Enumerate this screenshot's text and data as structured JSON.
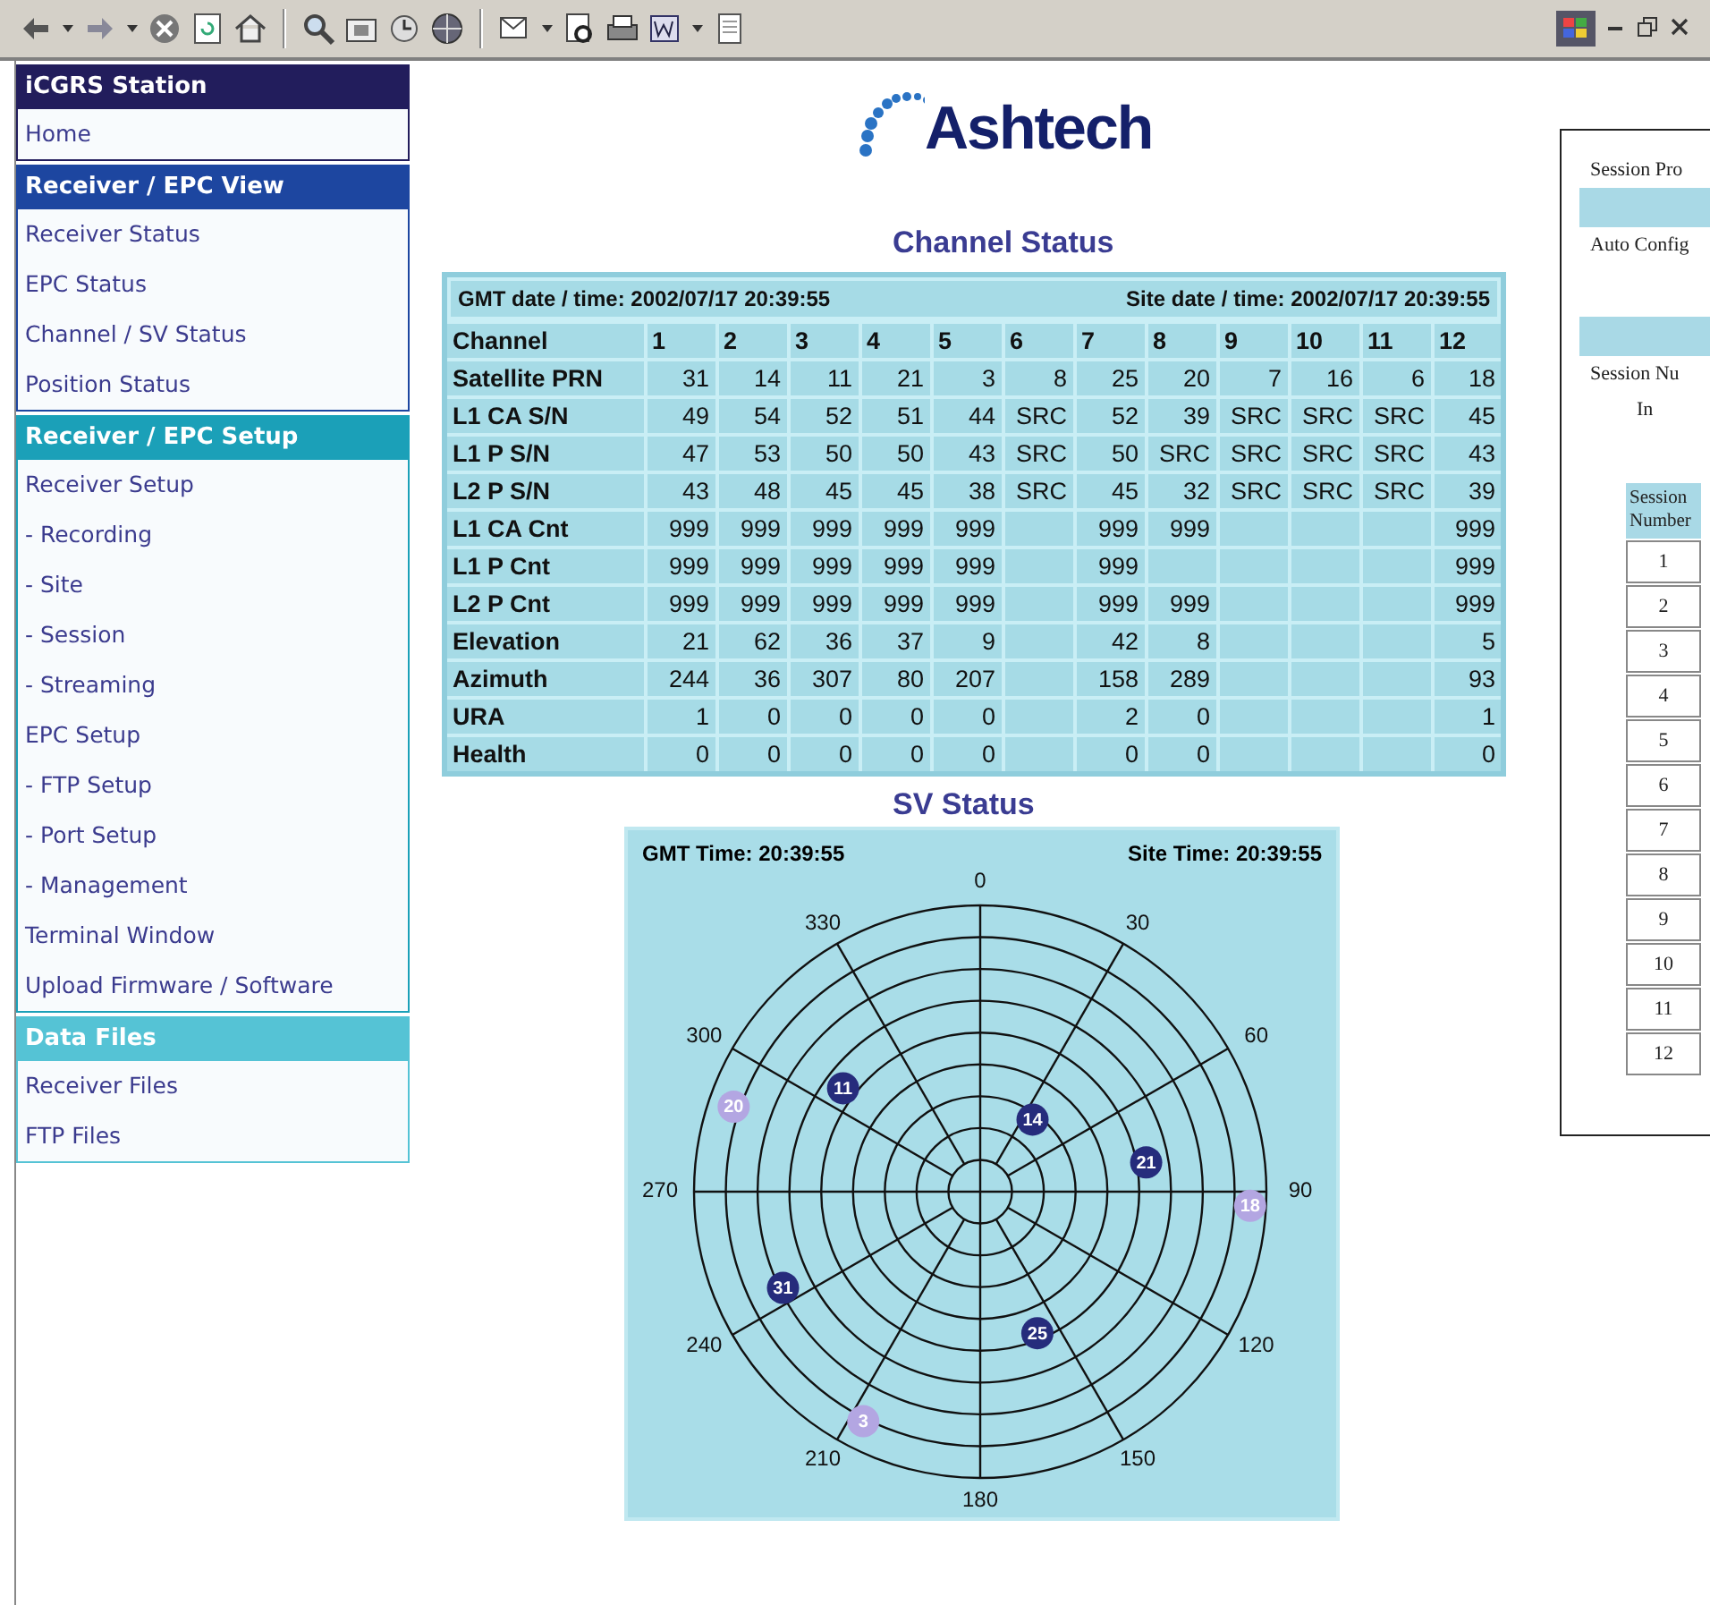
{
  "sidebar": {
    "sections": [
      {
        "title": "iCGRS Station",
        "color": "#221d5c",
        "items": [
          "Home"
        ]
      },
      {
        "title": "Receiver / EPC View",
        "color": "#1d46a0",
        "items": [
          "Receiver Status",
          "EPC Status",
          "Channel / SV Status",
          "Position Status"
        ]
      },
      {
        "title": "Receiver / EPC Setup",
        "color": "#1ba0b8",
        "items": [
          "Receiver Setup",
          "- Recording",
          "- Site",
          "- Session",
          "- Streaming",
          "EPC Setup",
          "- FTP Setup",
          "- Port Setup",
          "- Management",
          "Terminal Window",
          "Upload Firmware / Software"
        ]
      },
      {
        "title": "Data Files",
        "color": "#55c3d5",
        "items": [
          "Receiver Files",
          "FTP Files"
        ]
      }
    ]
  },
  "logo": {
    "text": "Ashtech"
  },
  "channel_status": {
    "title": "Channel Status",
    "gmt": "GMT date / time: 2002/07/17 20:39:55",
    "site": "Site date / time: 2002/07/17 20:39:55",
    "rows": [
      {
        "kind": "header",
        "label": "Channel",
        "cells": [
          "1",
          "2",
          "3",
          "4",
          "5",
          "6",
          "7",
          "8",
          "9",
          "10",
          "11",
          "12"
        ]
      },
      {
        "kind": "data",
        "label": "Satellite PRN",
        "cells": [
          "31",
          "14",
          "11",
          "21",
          "3",
          "8",
          "25",
          "20",
          "7",
          "16",
          "6",
          "18"
        ]
      },
      {
        "kind": "data",
        "label": "L1 CA S/N",
        "cells": [
          "49",
          "54",
          "52",
          "51",
          "44",
          "SRC",
          "52",
          "39",
          "SRC",
          "SRC",
          "SRC",
          "45"
        ]
      },
      {
        "kind": "data",
        "label": "L1 P S/N",
        "cells": [
          "47",
          "53",
          "50",
          "50",
          "43",
          "SRC",
          "50",
          "SRC",
          "SRC",
          "SRC",
          "SRC",
          "43"
        ]
      },
      {
        "kind": "data",
        "label": "L2 P S/N",
        "cells": [
          "43",
          "48",
          "45",
          "45",
          "38",
          "SRC",
          "45",
          "32",
          "SRC",
          "SRC",
          "SRC",
          "39"
        ]
      },
      {
        "kind": "data",
        "label": "L1 CA Cnt",
        "cells": [
          "999",
          "999",
          "999",
          "999",
          "999",
          null,
          "999",
          "999",
          null,
          null,
          null,
          "999"
        ]
      },
      {
        "kind": "data",
        "label": "L1 P Cnt",
        "cells": [
          "999",
          "999",
          "999",
          "999",
          "999",
          null,
          "999",
          null,
          null,
          null,
          null,
          "999"
        ]
      },
      {
        "kind": "data",
        "label": "L2 P Cnt",
        "cells": [
          "999",
          "999",
          "999",
          "999",
          "999",
          null,
          "999",
          "999",
          null,
          null,
          null,
          "999"
        ]
      },
      {
        "kind": "elevation",
        "label": "Elevation",
        "cells": [
          "21",
          "62",
          "36",
          "37",
          "9",
          null,
          "42",
          "8",
          null,
          null,
          null,
          "5"
        ]
      },
      {
        "kind": "azimuth",
        "label": "Azimuth",
        "cells": [
          "244",
          "36",
          "307",
          "80",
          "207",
          null,
          "158",
          "289",
          null,
          null,
          null,
          "93"
        ]
      },
      {
        "kind": "data",
        "label": "URA",
        "cells": [
          "1",
          "0",
          "0",
          "0",
          "0",
          null,
          "2",
          "0",
          null,
          null,
          null,
          "1"
        ]
      },
      {
        "kind": "data",
        "label": "Health",
        "cells": [
          "0",
          "0",
          "0",
          "0",
          "0",
          null,
          "0",
          "0",
          null,
          null,
          null,
          "0"
        ]
      }
    ]
  },
  "sv_status": {
    "title": "SV Status",
    "gmt": "GMT Time: 20:39:55",
    "site": "Site Time: 20:39:55",
    "azimuth_labels": [
      "0",
      "30",
      "60",
      "90",
      "120",
      "150",
      "180",
      "210",
      "240",
      "270",
      "300",
      "330"
    ],
    "satellites": [
      {
        "label": "31",
        "color": "#262c7c"
      },
      {
        "label": "14",
        "color": "#262c7c"
      },
      {
        "label": "11",
        "color": "#262c7c"
      },
      {
        "label": "21",
        "color": "#262c7c"
      },
      {
        "label": "3",
        "color": "#b3a6e2"
      },
      {
        "label": "25",
        "color": "#262c7c"
      },
      {
        "label": "20",
        "color": "#b3a6e2"
      },
      {
        "label": "18",
        "color": "#b3a6e2"
      }
    ]
  },
  "side_window": {
    "lines": [
      {
        "kind": "text",
        "text": "Session Pro"
      },
      {
        "kind": "bar"
      },
      {
        "kind": "text",
        "text": "Auto Config"
      },
      {
        "kind": "space"
      },
      {
        "kind": "bar"
      },
      {
        "kind": "text",
        "text": "Session Nu"
      },
      {
        "kind": "indent",
        "text": "In"
      }
    ],
    "table": {
      "header": "Session Number",
      "rows": [
        "1",
        "2",
        "3",
        "4",
        "5",
        "6",
        "7",
        "8",
        "9",
        "10",
        "11",
        "12"
      ]
    }
  }
}
